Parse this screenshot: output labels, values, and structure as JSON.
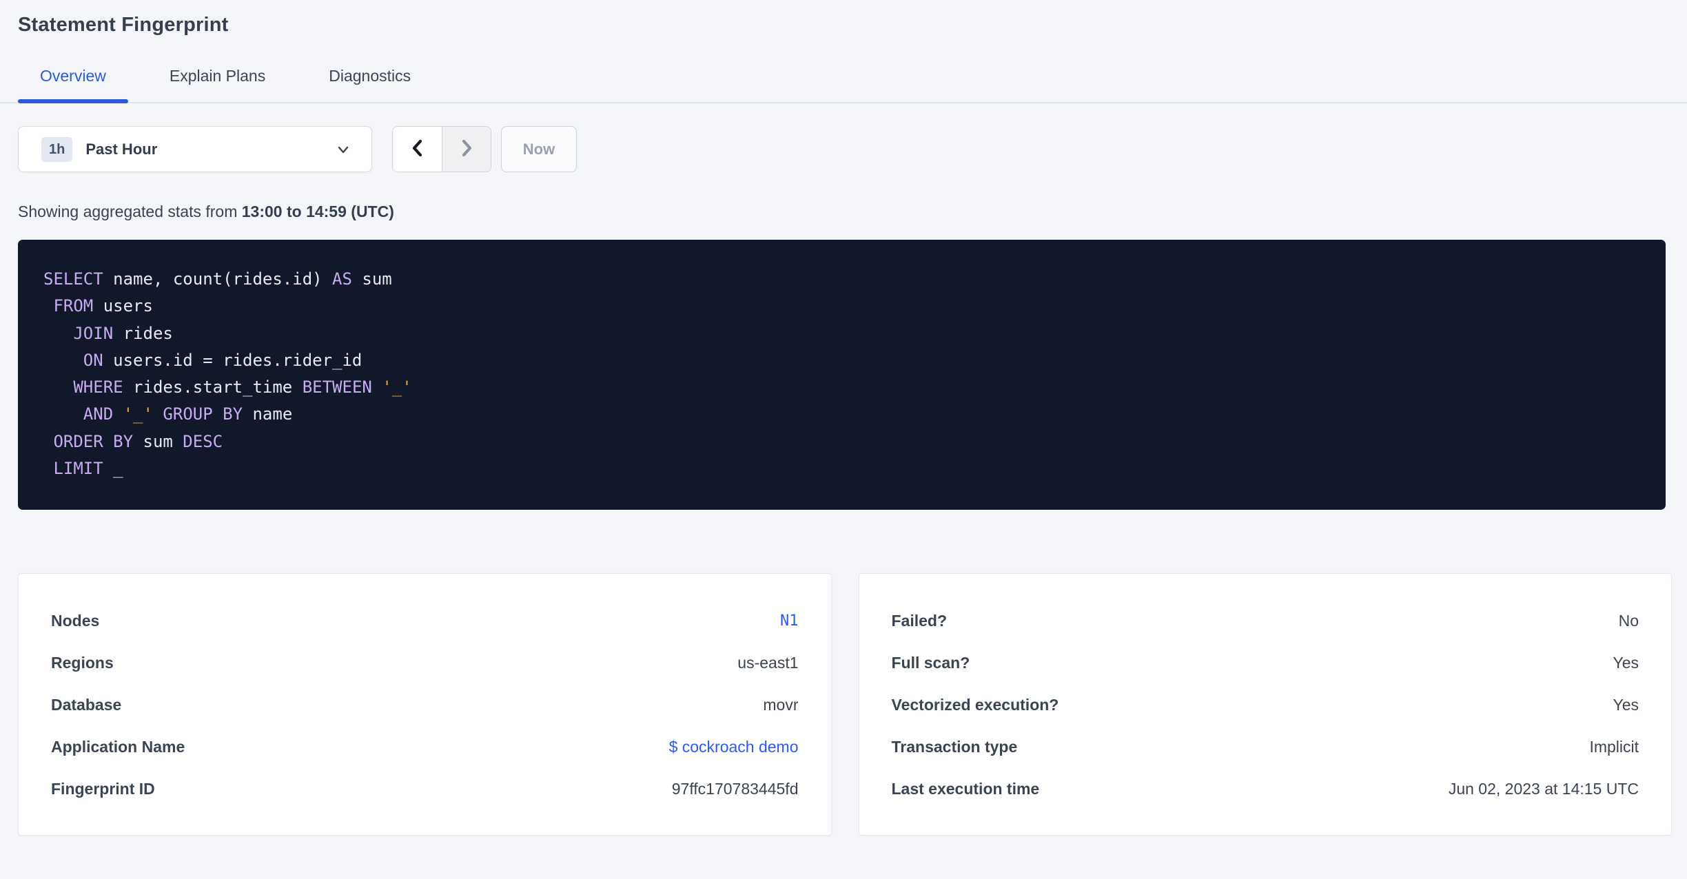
{
  "page": {
    "title": "Statement Fingerprint"
  },
  "tabs": [
    {
      "label": "Overview",
      "active": true
    },
    {
      "label": "Explain Plans",
      "active": false
    },
    {
      "label": "Diagnostics",
      "active": false
    }
  ],
  "time_picker": {
    "badge": "1h",
    "selected_label": "Past Hour",
    "prev_icon": "chevron-left",
    "next_icon": "chevron-right",
    "now_label": "Now"
  },
  "stats": {
    "prefix": "Showing aggregated stats from ",
    "range": "13:00 to 14:59 (UTC)"
  },
  "colors": {
    "accent_blue": "#2d5ad6",
    "link_blue": "#2b5cf2",
    "sql_background": "#111829",
    "sql_keyword": "#c8abf1",
    "sql_identifier": "#e8eaf1",
    "sql_string": "#e2a24a",
    "page_background": "#f4f5f9"
  },
  "sql": {
    "lines": [
      [
        [
          "kw",
          "SELECT"
        ],
        [
          "id",
          " name, count(rides.id) "
        ],
        [
          "kw",
          "AS"
        ],
        [
          "id",
          " sum"
        ]
      ],
      [
        [
          "id",
          " "
        ],
        [
          "kw",
          "FROM"
        ],
        [
          "id",
          " users"
        ]
      ],
      [
        [
          "id",
          "   "
        ],
        [
          "kw",
          "JOIN"
        ],
        [
          "id",
          " rides"
        ]
      ],
      [
        [
          "id",
          "    "
        ],
        [
          "kw",
          "ON"
        ],
        [
          "id",
          " users.id = rides.rider_id"
        ]
      ],
      [
        [
          "id",
          "   "
        ],
        [
          "kw",
          "WHERE"
        ],
        [
          "id",
          " rides.start_time "
        ],
        [
          "kw",
          "BETWEEN"
        ],
        [
          "id",
          " "
        ],
        [
          "str",
          "'_'"
        ]
      ],
      [
        [
          "id",
          "    "
        ],
        [
          "kw",
          "AND"
        ],
        [
          "id",
          " "
        ],
        [
          "str",
          "'_'"
        ],
        [
          "id",
          " "
        ],
        [
          "kw",
          "GROUP BY"
        ],
        [
          "id",
          " name"
        ]
      ],
      [
        [
          "id",
          " "
        ],
        [
          "kw",
          "ORDER BY"
        ],
        [
          "id",
          " sum "
        ],
        [
          "kw",
          "DESC"
        ]
      ],
      [
        [
          "id",
          " "
        ],
        [
          "kw",
          "LIMIT"
        ],
        [
          "id",
          " _"
        ]
      ]
    ]
  },
  "cards": {
    "left": {
      "rows": [
        {
          "label": "Nodes",
          "value": "N1",
          "link": true,
          "mono": true
        },
        {
          "label": "Regions",
          "value": "us-east1",
          "link": false,
          "mono": false
        },
        {
          "label": "Database",
          "value": "movr",
          "link": false,
          "mono": false
        },
        {
          "label": "Application Name",
          "value": "$ cockroach demo",
          "link": true,
          "mono": false
        },
        {
          "label": "Fingerprint ID",
          "value": "97ffc170783445fd",
          "link": false,
          "mono": false
        }
      ]
    },
    "right": {
      "rows": [
        {
          "label": "Failed?",
          "value": "No",
          "link": false,
          "mono": false
        },
        {
          "label": "Full scan?",
          "value": "Yes",
          "link": false,
          "mono": false
        },
        {
          "label": "Vectorized execution?",
          "value": "Yes",
          "link": false,
          "mono": false
        },
        {
          "label": "Transaction type",
          "value": "Implicit",
          "link": false,
          "mono": false
        },
        {
          "label": "Last execution time",
          "value": "Jun 02, 2023 at 14:15 UTC",
          "link": false,
          "mono": false
        }
      ]
    }
  }
}
